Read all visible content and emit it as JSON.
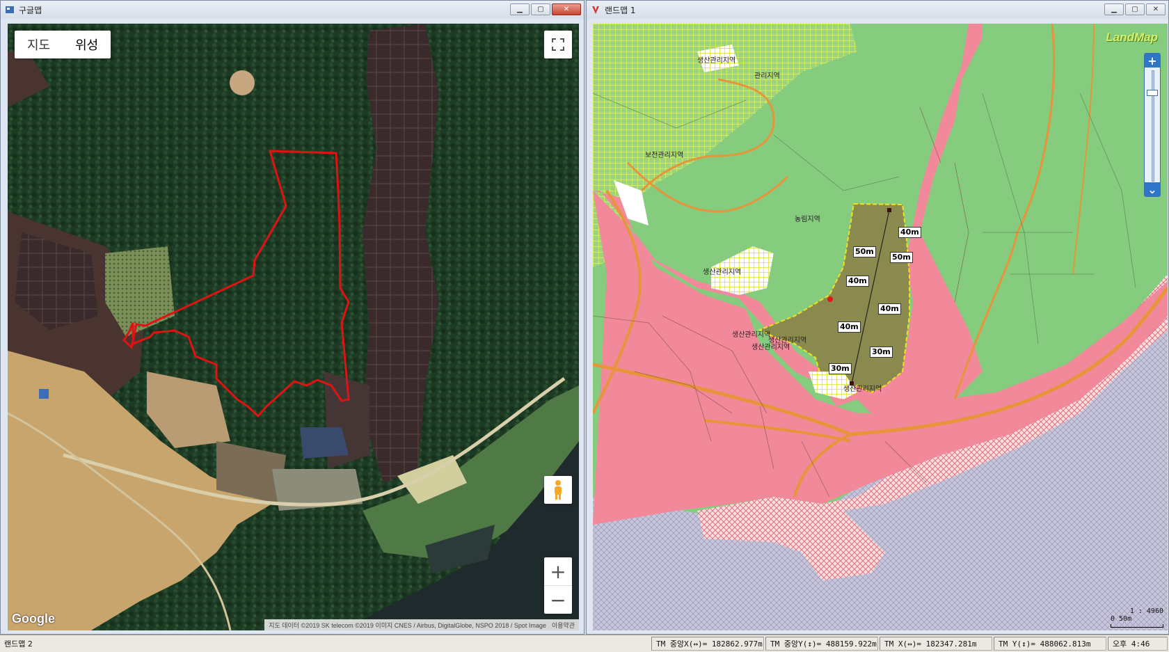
{
  "google_window": {
    "title": "구글맵",
    "map_type": {
      "map": "지도",
      "satellite": "위성",
      "selected": "위성"
    },
    "logo": "Google",
    "attribution": "지도 데이터 ©2019 SK telecom ©2019 이미지 CNES / Airbus, DigitalGlobe, NSPO 2018 / Spot Image",
    "terms": "이용약관",
    "icons": [
      "fullscreen-icon",
      "pegman-icon",
      "zoom-in-icon",
      "zoom-out-icon"
    ]
  },
  "landmap_window": {
    "title": "랜드맵 1",
    "logo": "LandMap",
    "scale_ratio": "1 : 4960",
    "scale_bar": "0   50m",
    "zone_labels": [
      "생산관리지역",
      "관리지역",
      "보전관리지역",
      "농림지역",
      "생산관리지역",
      "생산관리지역",
      "생산관리지역",
      "생산관리지역",
      "생산관리지역"
    ],
    "distance_labels": [
      "40m",
      "50m",
      "50m",
      "40m",
      "40m",
      "40m",
      "30m",
      "30m"
    ],
    "colors": {
      "agricultural": "#85cc7e",
      "production_mgmt": "#d8f08a",
      "urban": "#f2899a",
      "water": "#c8c8e0",
      "parcel_fill": "#8a8a4e",
      "road": "#e8943a"
    }
  },
  "status_bar": {
    "window_label": "랜드맵 2",
    "tm_center_x": "TM 중앙X(↔)= 182862.977m",
    "tm_center_y": "TM 중앙Y(↕)= 488159.922m",
    "tm_x": "TM X(↔)= 182347.281m",
    "tm_y": "TM Y(↕)= 488062.813m",
    "clock": "오후 4:46"
  }
}
